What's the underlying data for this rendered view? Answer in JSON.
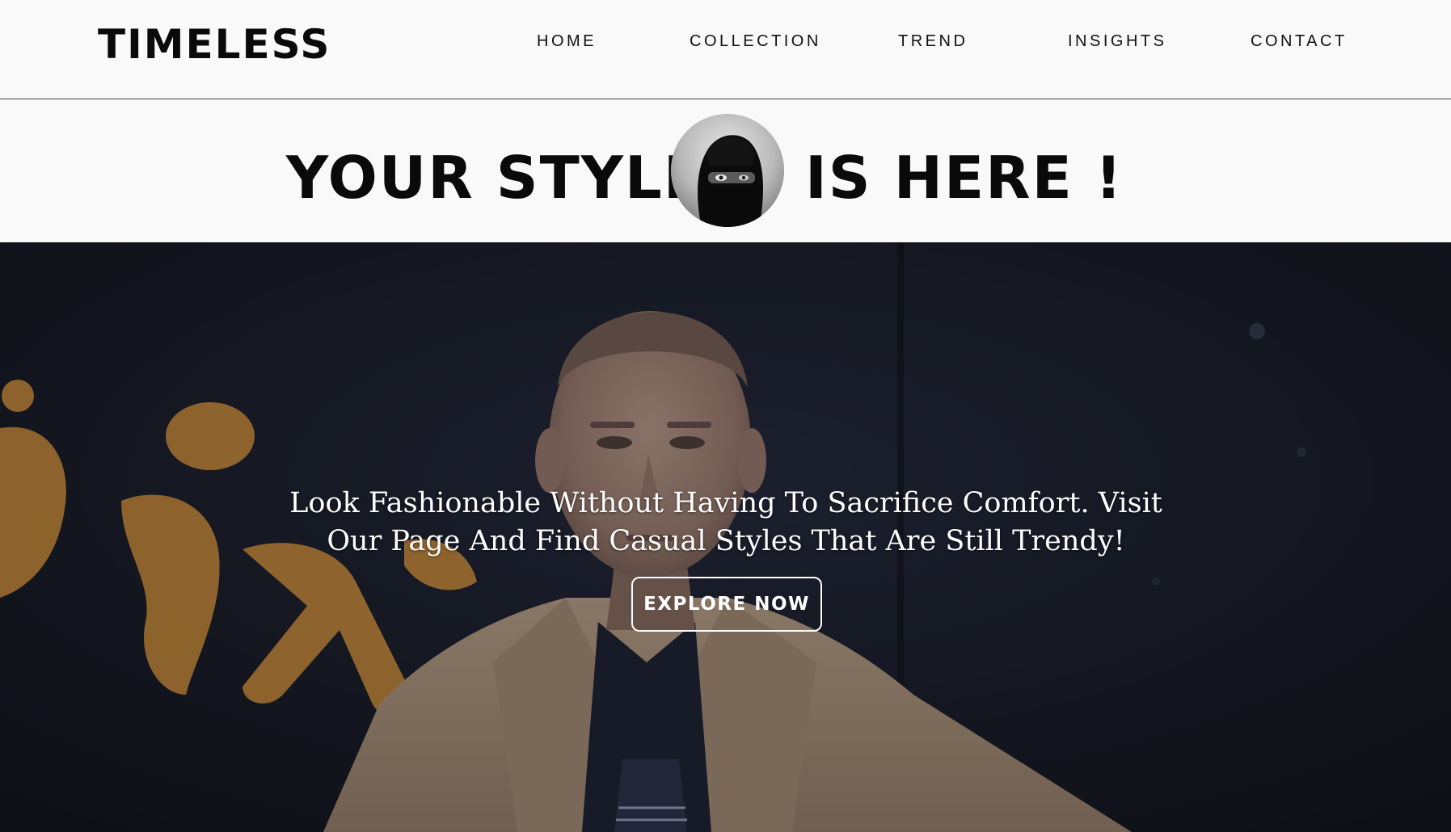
{
  "brand": {
    "logo": "TIMELESS"
  },
  "nav": {
    "items": [
      {
        "label": "HOME"
      },
      {
        "label": "COLLECTION"
      },
      {
        "label": "TREND"
      },
      {
        "label": "INSIGHTS"
      },
      {
        "label": "CONTACT"
      }
    ]
  },
  "banner": {
    "left_text": "YOUR STYLE",
    "right_text": "IS HERE !",
    "avatar_icon": "hooded-person-portrait"
  },
  "hero": {
    "tagline": "Look Fashionable Without Having To Sacrifice Comfort. Visit Our Page And Find Casual Styles That Are Still Trendy!",
    "cta_label": "EXPLORE NOW",
    "background_icon": "man-portrait-photo",
    "graffiti_color": "#c8893a"
  },
  "colors": {
    "background": "#f9f9f9",
    "text": "#0a0a0a",
    "hero_dark": "#1b1e2b",
    "cta_border": "#ffffff"
  }
}
